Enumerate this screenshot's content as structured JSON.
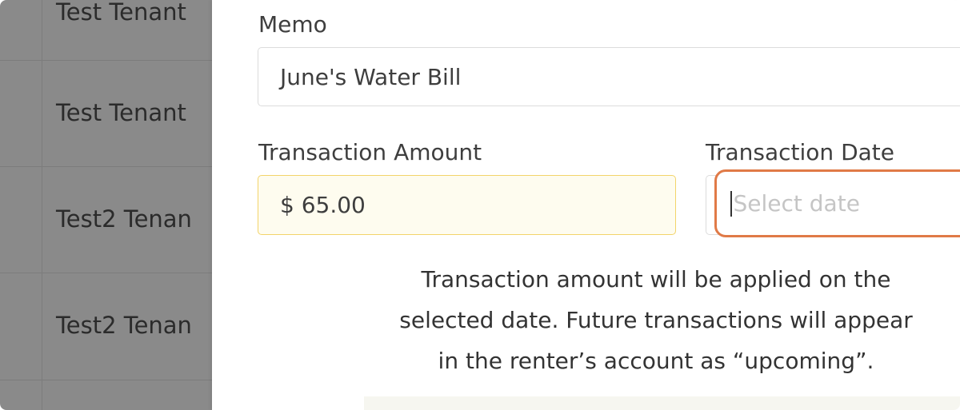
{
  "background_table": {
    "rows": [
      {
        "name": "Test Tenant"
      },
      {
        "name": "Test Tenant"
      },
      {
        "name": "Test2 Tenan"
      },
      {
        "name": "Test2 Tenan"
      }
    ]
  },
  "form": {
    "memo": {
      "label": "Memo",
      "value": "June's Water Bill"
    },
    "amount": {
      "label": "Transaction Amount",
      "value": "$ 65.00"
    },
    "date": {
      "label": "Transaction Date",
      "placeholder": "Select date"
    },
    "help_text_lines": [
      "Transaction amount will be applied on the",
      "selected date. Future transactions will appear",
      "in the renter’s account as “upcoming”."
    ]
  },
  "colors": {
    "overlay": "#8a8a8a",
    "date_focus_ring": "#e07a47",
    "amount_border": "#f3d46a"
  }
}
